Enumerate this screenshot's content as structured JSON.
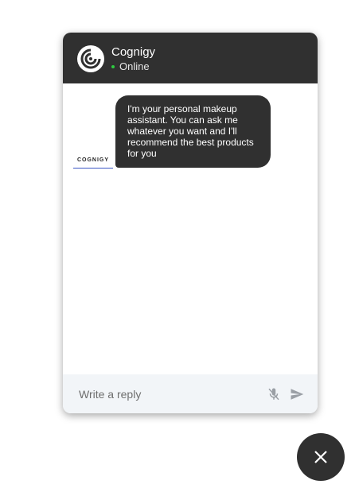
{
  "header": {
    "bot_name": "Cognigy",
    "status": "Online",
    "avatar_icon": "cognigy-logo-icon",
    "status_color": "#2ecc40",
    "background": "#303030"
  },
  "messages": [
    {
      "sender": "bot",
      "text": "I'm your personal makeup assistant. You can ask me whatever you want and I'll recommend the best products for you",
      "avatar_label": "COGNIGY"
    }
  ],
  "input": {
    "placeholder": "Write a reply",
    "value": "",
    "mic_icon": "microphone-off-icon",
    "send_icon": "send-icon"
  },
  "fab": {
    "icon": "close-icon"
  }
}
